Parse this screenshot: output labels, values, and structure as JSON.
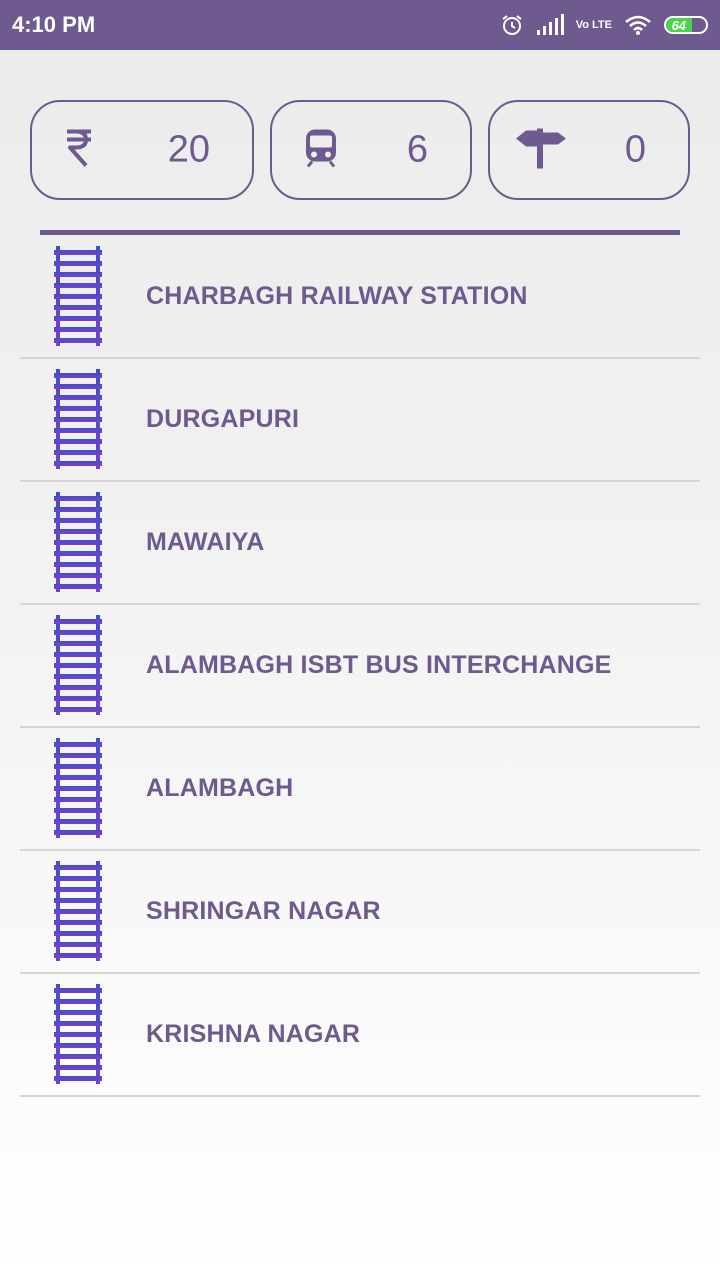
{
  "status_bar": {
    "time": "4:10 PM",
    "network": "Vo LTE",
    "battery_level": "64",
    "battery_percent": 64,
    "background_color": "#6e5a8f",
    "icons": [
      "alarm-icon",
      "signal-icon",
      "lte-icon",
      "wifi-icon",
      "battery-icon"
    ]
  },
  "stats": {
    "fare": {
      "icon": "rupee-icon",
      "value": "20"
    },
    "stations": {
      "icon": "metro-train-icon",
      "value": "6"
    },
    "interchanges": {
      "icon": "signpost-icon",
      "value": "0"
    }
  },
  "accent_color": "#6e5a8f",
  "stations": [
    {
      "name": "CHARBAGH RAILWAY STATION",
      "icon": "railway-track-icon"
    },
    {
      "name": "DURGAPURI",
      "icon": "railway-track-icon"
    },
    {
      "name": "MAWAIYA",
      "icon": "railway-track-icon"
    },
    {
      "name": "ALAMBAGH ISBT BUS INTERCHANGE",
      "icon": "railway-track-icon"
    },
    {
      "name": "ALAMBAGH",
      "icon": "railway-track-icon"
    },
    {
      "name": "SHRINGAR NAGAR",
      "icon": "railway-track-icon"
    },
    {
      "name": "KRISHNA NAGAR",
      "icon": "railway-track-icon"
    }
  ]
}
